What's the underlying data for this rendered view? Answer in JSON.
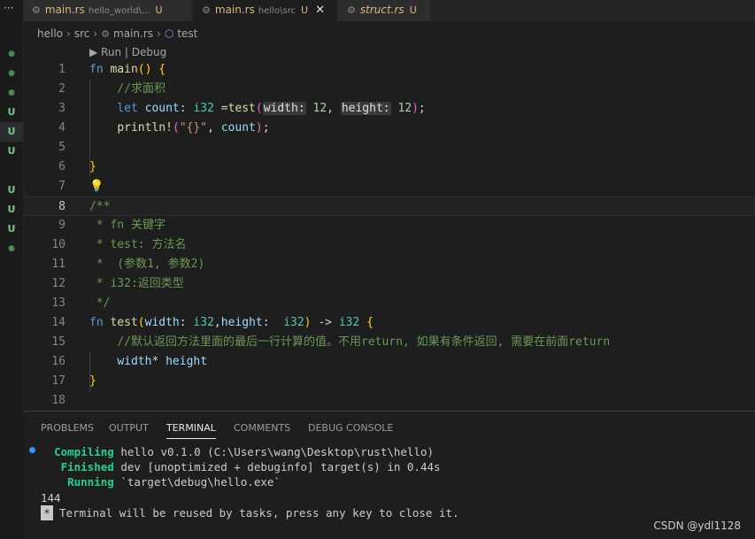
{
  "sidebar_gutter": {
    "ellipsis": "···",
    "markers": [
      "●",
      "●",
      "●",
      "U",
      "U",
      "U",
      "",
      "U",
      "U",
      "U",
      "●"
    ]
  },
  "tabs": [
    {
      "name": "main.rs",
      "desc": "hello_world\\...",
      "status": "U",
      "active": false,
      "italic": false,
      "close": ""
    },
    {
      "name": "main.rs",
      "desc": "hello\\src",
      "status": "U",
      "active": true,
      "italic": false,
      "close": "✕"
    },
    {
      "name": "struct.rs",
      "desc": "",
      "status": "U",
      "active": false,
      "italic": true,
      "close": ""
    }
  ],
  "breadcrumb": {
    "p1": "hello",
    "p2": "src",
    "p3": "main.rs",
    "p4": "test"
  },
  "codelens": "▶ Run | Debug",
  "editor": {
    "lines": {
      "l1": "1",
      "l2": "2",
      "l3": "3",
      "l4": "4",
      "l5": "5",
      "l6": "6",
      "l7": "7",
      "l8": "8",
      "l9": "9",
      "l10": "10",
      "l11": "11",
      "l12": "12",
      "l13": "13",
      "l14": "14",
      "l15": "15",
      "l16": "16",
      "l17": "17",
      "l18": "18"
    },
    "kw_fn": "fn",
    "main_fn": "main",
    "paren_open": "(",
    "paren_close": ")",
    "brace_open": "{",
    "brace_close": "}",
    "comment_area": "//求面积",
    "kw_let": "let",
    "var_count": "count",
    "colon_sp": ": ",
    "type_i32": "i32",
    "assign": " =",
    "fn_test": "test",
    "hint_width": "width:",
    "num_12a": "12",
    "comma_sp": ", ",
    "hint_height": "height:",
    "num_12b": "12",
    "semi": ";",
    "macro_println": "println!",
    "str_fmt": "\"{}\"",
    "doc_open": "/**",
    "doc_l9": " * fn 关键字",
    "doc_l10": " * test: 方法名",
    "doc_l11": " *  (参数1, 参数2)",
    "doc_l12": " * i32:返回类型",
    "doc_l13": " */",
    "param_width": "width",
    "type_i32_b": "i32",
    "comma": ",",
    "param_height": "height",
    "colon_wide": ":  ",
    "type_i32_c": "i32",
    "arrow": " -> ",
    "type_i32_d": "i32",
    "comment_return": "//默认返回方法里面的最后一行计算的值。不用return, 如果有条件返回, 需要在前面return",
    "expr_width": "width",
    "mul": "* ",
    "expr_height": "height"
  },
  "panel": {
    "tabs": [
      "PROBLEMS",
      "OUTPUT",
      "TERMINAL",
      "COMMENTS",
      "DEBUG CONSOLE"
    ],
    "active_tab": "TERMINAL",
    "term": {
      "compiling_label": "Compiling",
      "compiling_text": " hello v0.1.0 (C:\\Users\\wang\\Desktop\\rust\\hello)",
      "finished_label": "Finished",
      "finished_text": " dev [unoptimized + debuginfo] target(s) in 0.44s",
      "running_label": "Running",
      "running_text": " `target\\debug\\hello.exe`",
      "output": "144",
      "box": "*",
      "reuse_msg": "Terminal will be reused by tasks, press any key to close it."
    }
  },
  "watermark": "CSDN @ydl1128"
}
